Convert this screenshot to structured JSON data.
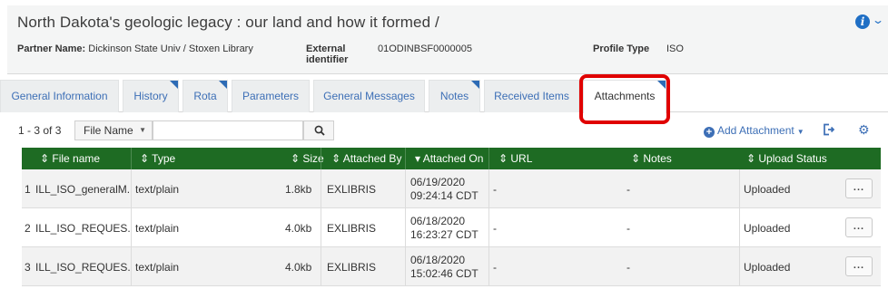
{
  "header": {
    "title": "North Dakota's geologic legacy : our land and how it formed /",
    "partner_label": "Partner Name:",
    "partner_value": "Dickinson State Univ / Stoxen Library",
    "external_id_label": "External identifier",
    "external_id_value": "01ODINBSF0000005",
    "profile_type_label": "Profile Type",
    "profile_type_value": "ISO",
    "icons": [
      "info-icon",
      "chevron-down-icon"
    ]
  },
  "tabs": [
    {
      "label": "General Information",
      "active": false
    },
    {
      "label": "History",
      "active": false,
      "flag": true
    },
    {
      "label": "Rota",
      "active": false,
      "flag": true
    },
    {
      "label": "Parameters",
      "active": false
    },
    {
      "label": "General Messages",
      "active": false
    },
    {
      "label": "Notes",
      "active": false,
      "flag": true
    },
    {
      "label": "Received Items",
      "active": false
    },
    {
      "label": "Attachments",
      "active": true,
      "flag": true
    }
  ],
  "toolbar": {
    "count": "1 - 3 of 3",
    "filter_select": "File Name",
    "search_value": "",
    "add_attachment": "Add Attachment"
  },
  "grid": {
    "columns": [
      "File name",
      "Type",
      "Size",
      "Attached By",
      "Attached On",
      "URL",
      "Notes",
      "Upload Status"
    ],
    "sort_column": "Attached On",
    "rows": [
      {
        "num": "1",
        "file": "ILL_ISO_generalM...",
        "type": "text/plain",
        "size": "1.8kb",
        "by": "EXLIBRIS",
        "on_date": "06/19/2020",
        "on_time": "09:24:14 CDT",
        "url": "-",
        "notes": "-",
        "status": "Uploaded"
      },
      {
        "num": "2",
        "file": "ILL_ISO_REQUES...",
        "type": "text/plain",
        "size": "4.0kb",
        "by": "EXLIBRIS",
        "on_date": "06/18/2020",
        "on_time": "16:23:27 CDT",
        "url": "-",
        "notes": "-",
        "status": "Uploaded"
      },
      {
        "num": "3",
        "file": "ILL_ISO_REQUES...",
        "type": "text/plain",
        "size": "4.0kb",
        "by": "EXLIBRIS",
        "on_date": "06/18/2020",
        "on_time": "15:02:46 CDT",
        "url": "-",
        "notes": "-",
        "status": "Uploaded"
      }
    ],
    "row_action": "..."
  },
  "colors": {
    "accent": "#3d6fb6",
    "grid_header": "#1e6b23",
    "highlight": "#e00000"
  }
}
